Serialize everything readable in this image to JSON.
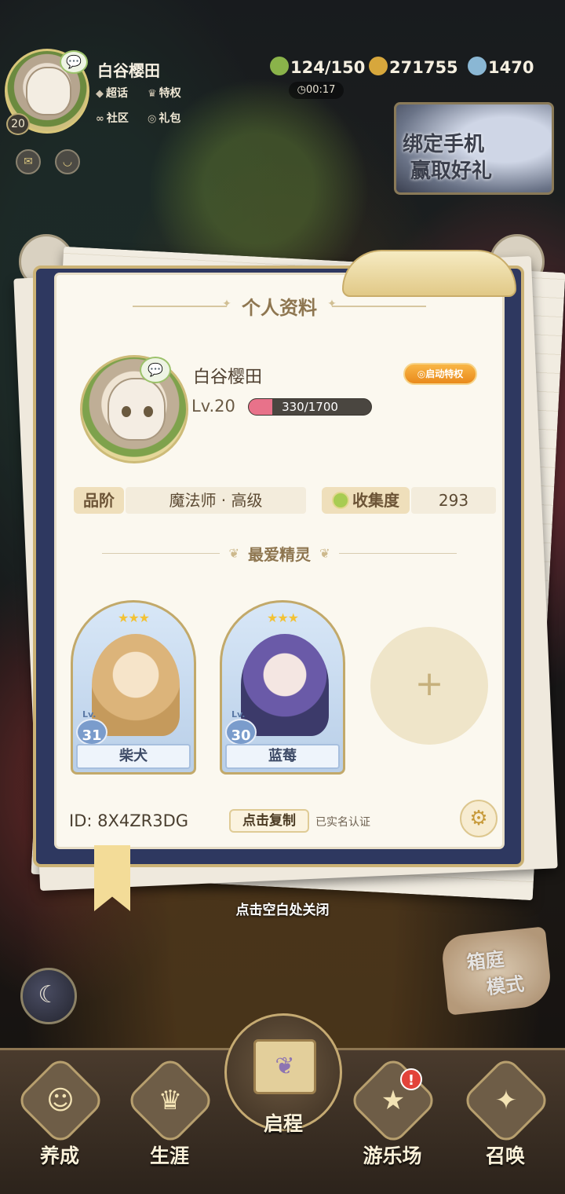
{
  "hud": {
    "player_name": "白谷樱田",
    "level": "20",
    "links": [
      {
        "icon": "diamond-icon",
        "label": "超话"
      },
      {
        "icon": "crown-icon",
        "label": "特权"
      },
      {
        "icon": "mask-icon",
        "label": "社区"
      },
      {
        "icon": "wechat-icon",
        "label": "礼包"
      }
    ],
    "stamina": "124/150",
    "coins": "271755",
    "gems": "1470",
    "timer": "00:17",
    "bind_banner": {
      "line1": "绑定手机",
      "line2": "赢取好礼"
    }
  },
  "profile": {
    "title": "个人资料",
    "name": "白谷樱田",
    "level_label": "Lv.20",
    "xp_text": "330/1700",
    "xp_fraction": 0.194,
    "privilege_button": "启动特权",
    "rank_label": "品阶",
    "rank_value": "魔法师 · 高级",
    "collection_label": "收集度",
    "collection_value": "293",
    "favorites_title": "最爱精灵",
    "favorites": [
      {
        "name": "柴犬",
        "level": "31",
        "lv_prefix": "Lv.",
        "stars": "★★★"
      },
      {
        "name": "蓝莓",
        "level": "30",
        "lv_prefix": "Lv.",
        "stars": "★★★"
      }
    ],
    "add_slot": "+",
    "id_label": "ID:",
    "id_value": "8X4ZR3DG",
    "copy_button": "点击复制",
    "verified": "已实名认证"
  },
  "close_hint": "点击空白处关闭",
  "garden_mode": {
    "line1": "箱庭",
    "line2": "模式"
  },
  "nav": {
    "items": [
      "养成",
      "生涯",
      "启程",
      "游乐场",
      "召唤"
    ],
    "alert": "!"
  },
  "colors": {
    "panel_bg": "#fbf8ef",
    "frame": "#2e3860",
    "gold": "#cbb275",
    "xp_fill": "#e8728a"
  }
}
